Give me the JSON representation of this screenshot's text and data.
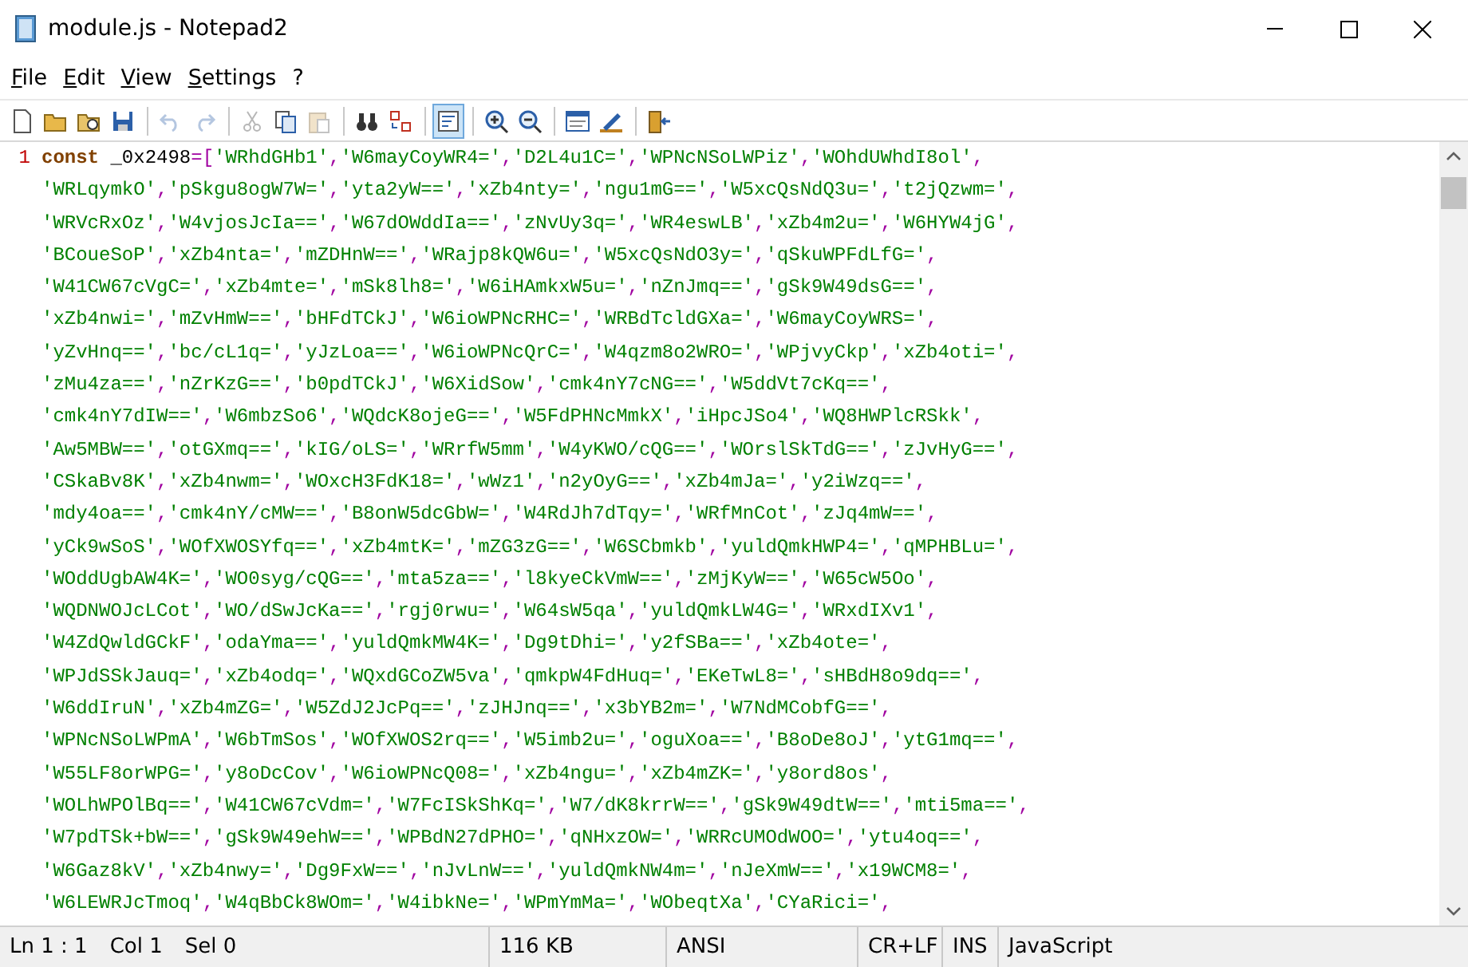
{
  "window": {
    "title": "module.js - Notepad2"
  },
  "menu": [
    {
      "label": "File"
    },
    {
      "label": "Edit"
    },
    {
      "label": "View"
    },
    {
      "label": "Settings"
    },
    {
      "label": "?"
    }
  ],
  "toolbar": [
    {
      "kind": "new",
      "disabled": false,
      "selected": false
    },
    {
      "kind": "open",
      "disabled": false,
      "selected": false
    },
    {
      "kind": "browse",
      "disabled": false,
      "selected": false
    },
    {
      "kind": "save",
      "disabled": false,
      "selected": false
    },
    {
      "kind": "separator"
    },
    {
      "kind": "undo",
      "disabled": true,
      "selected": false
    },
    {
      "kind": "redo",
      "disabled": true,
      "selected": false
    },
    {
      "kind": "separator"
    },
    {
      "kind": "cut",
      "disabled": true,
      "selected": false
    },
    {
      "kind": "copy",
      "disabled": false,
      "selected": false
    },
    {
      "kind": "paste",
      "disabled": true,
      "selected": false
    },
    {
      "kind": "separator"
    },
    {
      "kind": "find",
      "disabled": false,
      "selected": false
    },
    {
      "kind": "replace",
      "disabled": false,
      "selected": false
    },
    {
      "kind": "separator"
    },
    {
      "kind": "wrap",
      "disabled": false,
      "selected": true
    },
    {
      "kind": "separator"
    },
    {
      "kind": "zoomin",
      "disabled": false,
      "selected": false
    },
    {
      "kind": "zoomout",
      "disabled": false,
      "selected": false
    },
    {
      "kind": "separator"
    },
    {
      "kind": "scheme",
      "disabled": false,
      "selected": false
    },
    {
      "kind": "customize",
      "disabled": false,
      "selected": false
    },
    {
      "kind": "separator"
    },
    {
      "kind": "exit",
      "disabled": false,
      "selected": false
    }
  ],
  "editor": {
    "line_number": "1",
    "keyword": "const",
    "rows": [
      " _0x2498=['WRhdGHb1','W6mayCoyWR4=','D2L4u1C=','WPNcNSoLWPiz','WOhdUWhdI8ol',",
      "'WRLqymkO','pSkgu8ogW7W=','yta2yW==','xZb4nty=','ngu1mG==','W5xcQsNdQ3u=','t2jQzwm=',",
      "'WRVcRxOz','W4vjosJcIa==','W67dOWddIa==','zNvUy3q=','WR4eswLB','xZb4m2u=','W6HYW4jG',",
      "'BCoueSoP','xZb4nta=','mZDHnW==','WRajp8kQW6u=','W5xcQsNdO3y=','qSkuWPFdLfG=',",
      "'W41CW67cVgC=','xZb4mte=','mSk8lh8=','W6iHAmkxW5u=','nZnJmq==','gSk9W49dsG==',",
      "'xZb4nwi=','mZvHmW==','bHFdTCkJ','W6ioWPNcRHC=','WRBdTcldGXa=','W6mayCoyWRS=',",
      "'yZvHnq==','bc/cL1q=','yJzLoa==','W6ioWPNcQrC=','W4qzm8o2WRO=','WPjvyCkp','xZb4oti=',",
      "'zMu4za==','nZrKzG==','b0pdTCkJ','W6XidSow','cmk4nY7cNG==','W5ddVt7cKq==',",
      "'cmk4nY7dIW==','W6mbzSo6','WQdcK8ojeG==','W5FdPHNcMmkX','iHpcJSo4','WQ8HWPlcRSkk',",
      "'Aw5MBW==','otGXmq==','kIG/oLS=','WRrfW5mm','W4yKWO/cQG==','WOrslSkTdG==','zJvHyG==',",
      "'CSkaBv8K','xZb4nwm=','WOxcH3FdK18=','wWz1','n2yOyG==','xZb4mJa=','y2iWzq==',",
      "'mdy4oa==','cmk4nY/cMW==','B8onW5dcGbW=','W4RdJh7dTqy=','WRfMnCot','zJq4mW==',",
      "'yCk9wSoS','WOfXWOSYfq==','xZb4mtK=','mZG3zG==','W6SCbmkb','yuldQmkHWP4=','qMPHBLu=',",
      "'WOddUgbAW4K=','WO0syg/cQG==','mta5za==','l8kyeCkVmW==','zMjKyW==','W65cW5Oo',",
      "'WQDNWOJcLCot','WO/dSwJcKa==','rgj0rwu=','W64sW5qa','yuldQmkLW4G=','WRxdIXv1',",
      "'W4ZdQwldGCkF','odaYma==','yuldQmkMW4K=','Dg9tDhi=','y2fSBa==','xZb4ote=',",
      "'WPJdSSkJauq=','xZb4odq=','WQxdGCoZW5va','qmkpW4FdHuq=','EKeTwL8=','sHBdH8o9dq==',",
      "'W6ddIruN','xZb4mZG=','W5ZdJ2JcPq==','zJHJnq==','x3bYB2m=','W7NdMCobfG==',",
      "'WPNcNSoLWPmA','W6bTmSos','WOfXWOS2rq==','W5imb2u=','oguXoa==','B8oDe8oJ','ytG1mq==',",
      "'W55LF8orWPG=','y8oDcCov','W6ioWPNcQ08=','xZb4ngu=','xZb4mZK=','y8ord8os',",
      "'WOLhWPOlBq==','W41CW67cVdm=','W7FcISkShKq=','W7/dK8krrW==','gSk9W49dtW==','mti5ma==',",
      "'W7pdTSk+bW==','gSk9W49ehW==','WPBdN27dPHO=','qNHxzOW=','WRRcUMOdWOO=','ytu4oq==',",
      "'W6Gaz8kV','xZb4nwy=','Dg9FxW==','nJvLnW==','yuldQmkNW4m=','nJeXmW==','x19WCM8=',",
      "'W6LEWRJcTmoq','W4qBbCk8WOm=','W4ibkNe=','WPmYmMa=','WObeqtXa','CYaRici=',"
    ]
  },
  "status_bar": {
    "panes": [
      {
        "items": [
          "Ln 1 : 1",
          "Col 1",
          "Sel 0"
        ]
      },
      {
        "items": [
          "116 KB"
        ]
      },
      {
        "items": [
          "ANSI"
        ]
      },
      {
        "items": [
          "CR+LF"
        ]
      },
      {
        "items": [
          "INS"
        ]
      },
      {
        "items": [
          "JavaScript"
        ]
      }
    ]
  }
}
